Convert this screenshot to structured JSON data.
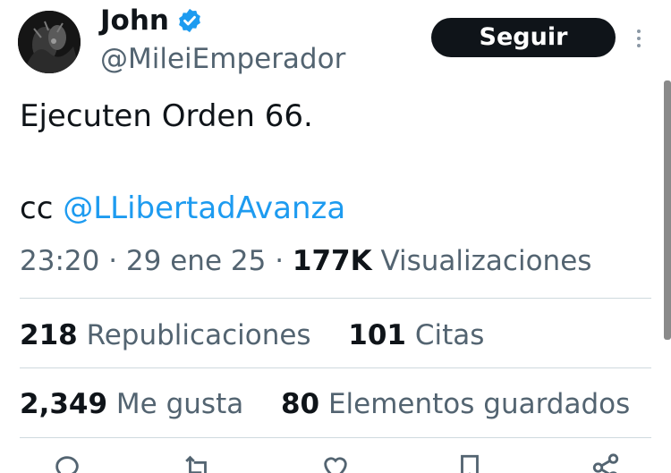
{
  "author": {
    "display_name": "John",
    "handle": "@MileiEmperador",
    "verified_icon": "verified-badge-icon",
    "avatar": "profile-avatar"
  },
  "header": {
    "follow_label": "Seguir",
    "more_icon": "more-vertical-icon"
  },
  "tweet": {
    "text": "Ejecuten Orden 66.",
    "cc_prefix": "cc",
    "mention": "@LLibertadAvanza"
  },
  "meta": {
    "time": "23:20",
    "separator1": "·",
    "date": "29 ene 25",
    "separator2": "·",
    "views_count": "177K",
    "views_label": "Visualizaciones"
  },
  "stats": {
    "reposts_count": "218",
    "reposts_label": "Republicaciones",
    "quotes_count": "101",
    "quotes_label": "Citas",
    "likes_count": "2,349",
    "likes_label": "Me gusta",
    "bookmarks_count": "80",
    "bookmarks_label": "Elementos guardados"
  },
  "actions": [
    "reply-icon",
    "repost-icon",
    "like-icon",
    "bookmark-icon",
    "share-icon"
  ],
  "colors": {
    "text": "#0f1419",
    "secondary": "#536471",
    "link": "#1d9bf0",
    "verified": "#1d9bf0",
    "button_bg": "#0f1419",
    "divider": "#cfd9de"
  }
}
